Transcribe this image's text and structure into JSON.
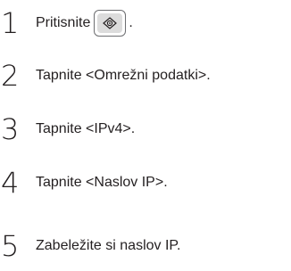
{
  "steps": [
    {
      "number": "1",
      "text": "Pritisnite",
      "suffix": ".",
      "key_icon": "settings-key-icon"
    },
    {
      "number": "2",
      "text": "Tapnite <Omrežni podatki>."
    },
    {
      "number": "3",
      "text": "Tapnite <IPv4>."
    },
    {
      "number": "4",
      "text": "Tapnite <Naslov IP>."
    },
    {
      "number": "5",
      "text": "Zabeležite si naslov IP."
    }
  ]
}
